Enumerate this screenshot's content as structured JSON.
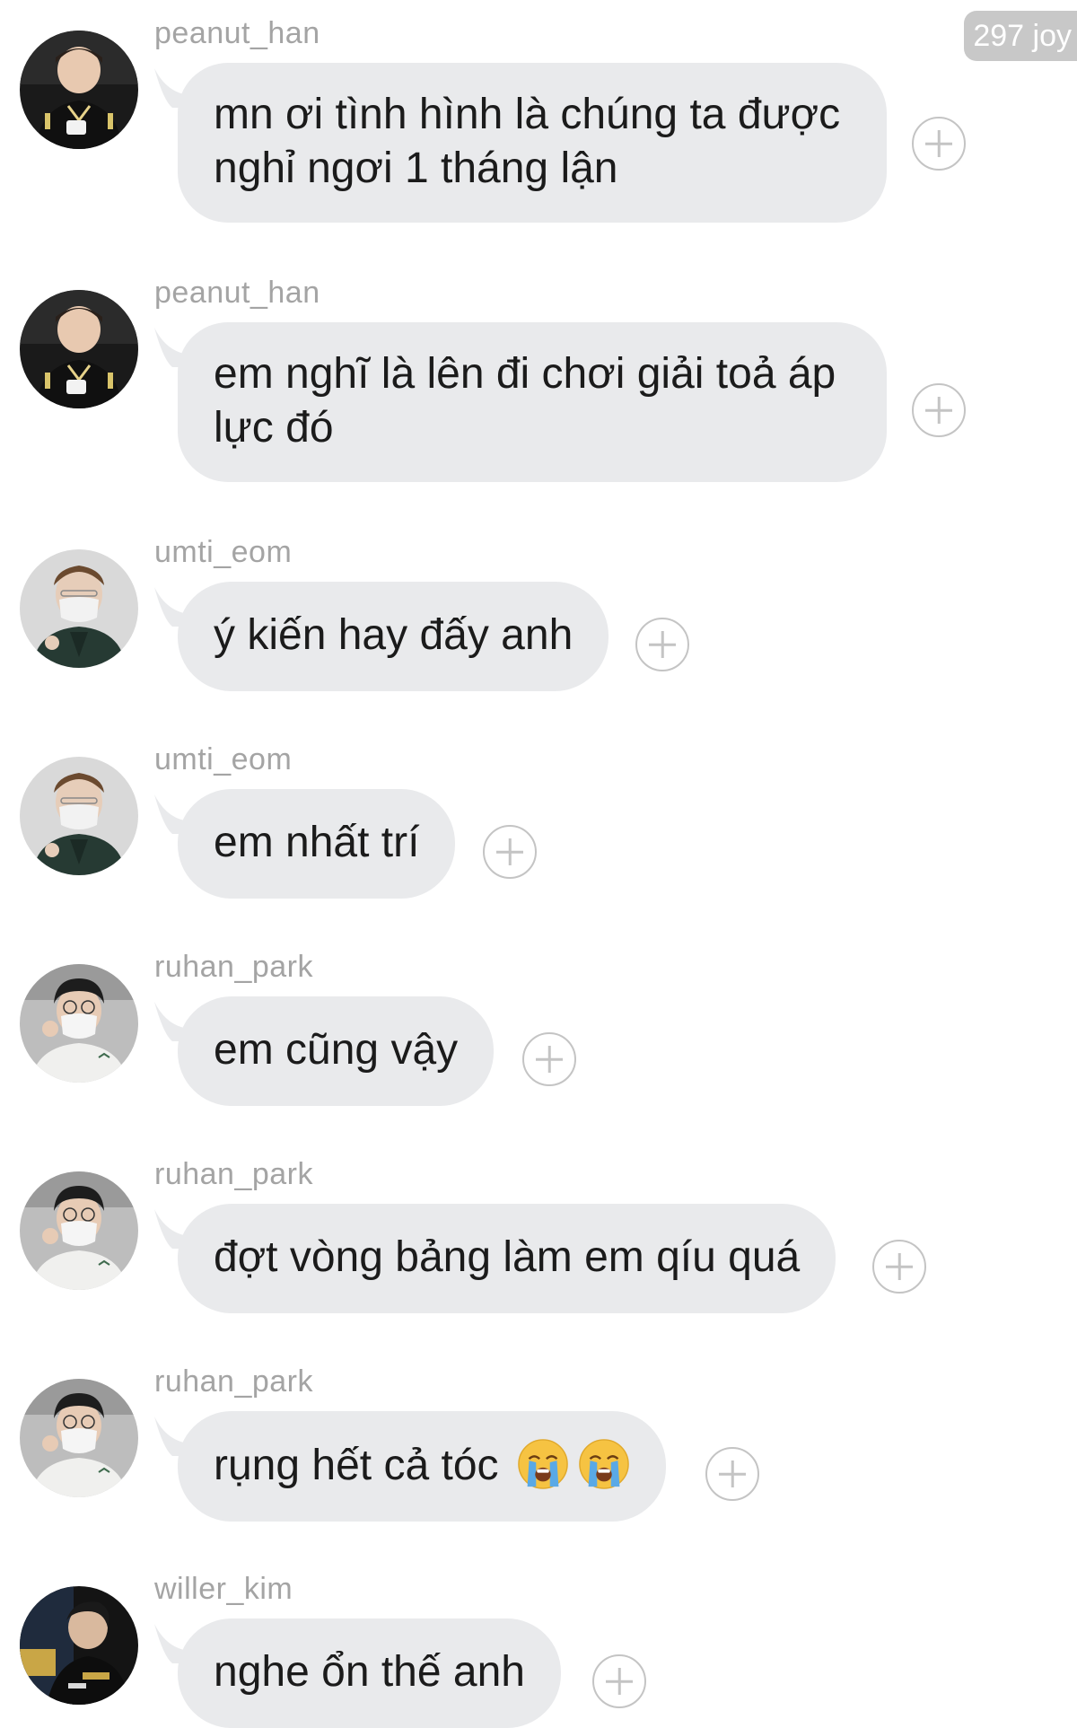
{
  "badge": {
    "label": "297 joy"
  },
  "messages": [
    {
      "username": "peanut_han",
      "text": "mn ơi tình hình là chúng ta được nghỉ ngơi 1 tháng lận",
      "avatar_icon": "player-photo-avatar"
    },
    {
      "username": "peanut_han",
      "text": "em nghĩ là lên đi chơi giải toả áp lực đó",
      "avatar_icon": "player-photo-avatar"
    },
    {
      "username": "umti_eom",
      "text": "ý kiến hay đấy anh",
      "avatar_icon": "player-photo-avatar"
    },
    {
      "username": "umti_eom",
      "text": "em nhất trí",
      "avatar_icon": "player-photo-avatar"
    },
    {
      "username": "ruhan_park",
      "text": "em cũng vậy",
      "avatar_icon": "player-photo-avatar"
    },
    {
      "username": "ruhan_park",
      "text": "đợt vòng bảng làm em qíu quá",
      "avatar_icon": "player-photo-avatar"
    },
    {
      "username": "ruhan_park",
      "text": "rụng hết cả tóc",
      "emoji": "loudly-crying-face-emoji",
      "emoji_count": 2,
      "avatar_icon": "player-photo-avatar"
    },
    {
      "username": "willer_kim",
      "text": "nghe ổn thế anh",
      "avatar_icon": "player-photo-avatar"
    }
  ],
  "colors": {
    "bubble": "#e9eaec",
    "username": "#a4a4a4",
    "text": "#1b1b1b",
    "plus_icon": "#c4c4c4",
    "badge": "#c8c8c8"
  }
}
